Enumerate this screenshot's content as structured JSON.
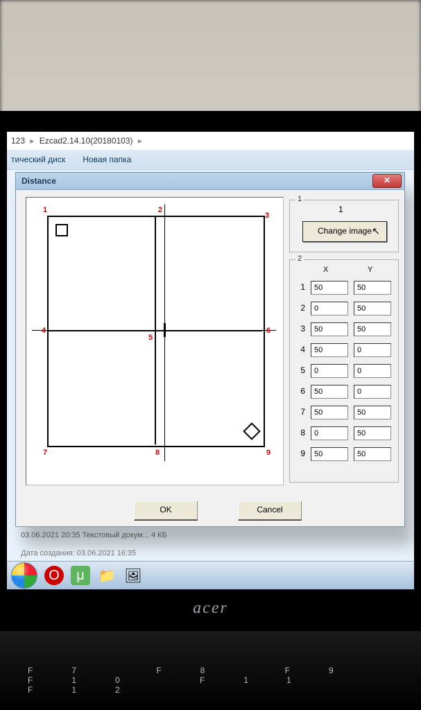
{
  "laptop_brand": "acer",
  "fn_keys": "F7     F8     F9     F10    F11    F12",
  "explorer": {
    "path_seg1": "123",
    "path_seg2": "Ezcad2.14.10(20180103)",
    "btn_disk": "тический диск",
    "btn_newfolder": "Новая папка",
    "prev_row": "03.06.2021 20:35     Текстовый докум...     4 КБ",
    "created": "Дата создания: 03.06.2021 16:35"
  },
  "dialog": {
    "title": "Distance",
    "close_glyph": "✕",
    "ok": "OK",
    "cancel": "Cancel",
    "group1": {
      "legend": "1",
      "one": "1",
      "change": "Change image"
    },
    "group2": {
      "legend": "2",
      "x": "X",
      "y": "Y"
    },
    "points": {
      "labels": [
        "1",
        "2",
        "3",
        "4",
        "5",
        "6",
        "7",
        "8",
        "9"
      ],
      "rows": [
        {
          "i": "1",
          "x": "50",
          "y": "50"
        },
        {
          "i": "2",
          "x": "0",
          "y": "50"
        },
        {
          "i": "3",
          "x": "50",
          "y": "50"
        },
        {
          "i": "4",
          "x": "50",
          "y": "0"
        },
        {
          "i": "5",
          "x": "0",
          "y": "0"
        },
        {
          "i": "6",
          "x": "50",
          "y": "0"
        },
        {
          "i": "7",
          "x": "50",
          "y": "50"
        },
        {
          "i": "8",
          "x": "0",
          "y": "50"
        },
        {
          "i": "9",
          "x": "50",
          "y": "50"
        }
      ]
    }
  },
  "taskbar": {
    "opera": "O",
    "utorrent": "μ",
    "explorer": "📁",
    "thumb": "🖼"
  }
}
